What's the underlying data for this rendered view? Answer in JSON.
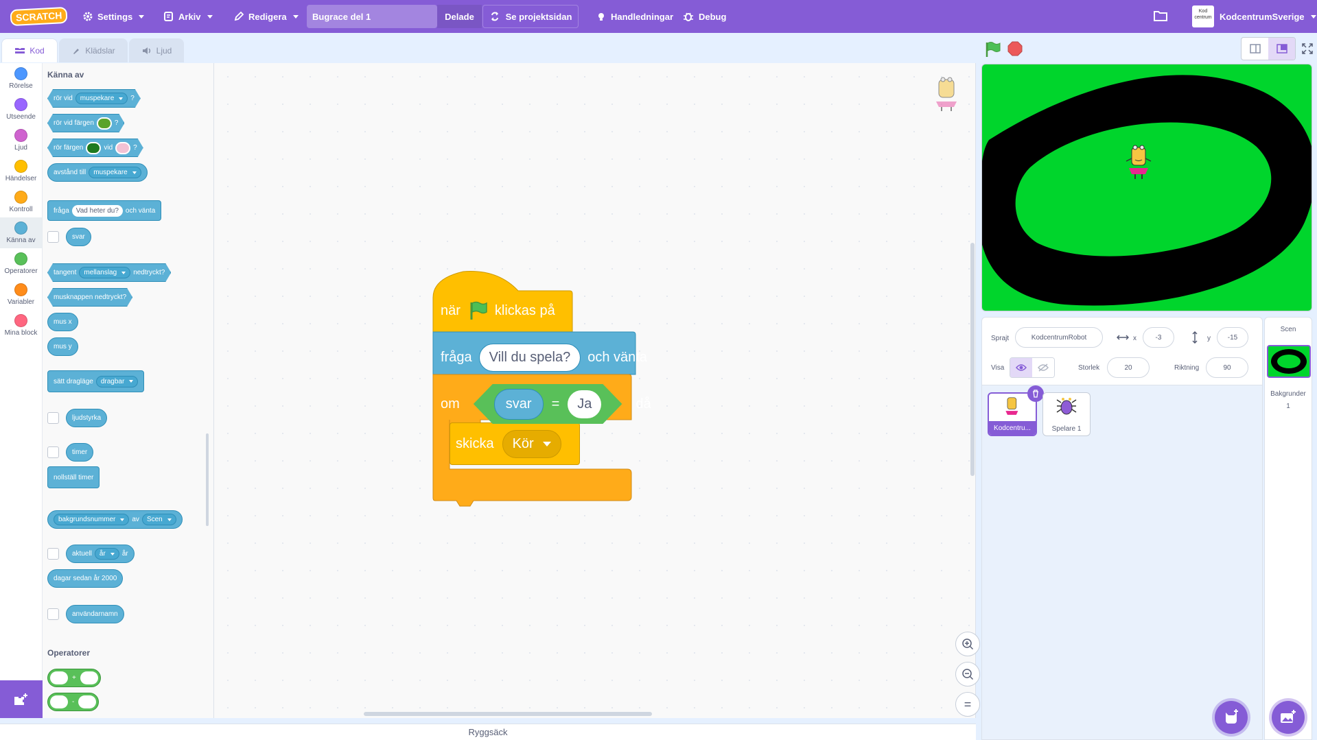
{
  "menu": {
    "logo": "SCRATCH",
    "settings": "Settings",
    "file": "Arkiv",
    "edit": "Redigera",
    "project_title": "Bugrace del 1",
    "shared": "Delade",
    "see_project_page": "Se projektsidan",
    "tutorials": "Handledningar",
    "debug": "Debug",
    "username": "KodcentrumSverige",
    "avatar_text": "Kod centrum"
  },
  "tabs": {
    "code": "Kod",
    "costumes": "Klädslar",
    "sounds": "Ljud"
  },
  "categories": [
    {
      "label": "Rörelse",
      "color": "#4c97ff"
    },
    {
      "label": "Utseende",
      "color": "#9966ff"
    },
    {
      "label": "Ljud",
      "color": "#cf63cf"
    },
    {
      "label": "Händelser",
      "color": "#ffbf00"
    },
    {
      "label": "Kontroll",
      "color": "#ffab19"
    },
    {
      "label": "Känna av",
      "color": "#5cb1d6"
    },
    {
      "label": "Operatorer",
      "color": "#59c059"
    },
    {
      "label": "Variabler",
      "color": "#ff8c1a"
    },
    {
      "label": "Mina block",
      "color": "#ff6680"
    }
  ],
  "palette": {
    "section_sensing": "Känna av",
    "touching_pre": "rör vid",
    "touching_dd": "muspekare",
    "q": "?",
    "touching_color_pre": "rör vid färgen",
    "color_touching_pre": "rör färgen",
    "color_touching_mid": "vid",
    "distance_pre": "avstånd till",
    "distance_dd": "muspekare",
    "ask_pre": "fråga",
    "ask_input": "Vad heter du?",
    "ask_post": "och vänta",
    "answer": "svar",
    "key_pre": "tangent",
    "key_dd": "mellanslag",
    "key_post": "nedtryckt?",
    "mouse_down": "musknappen nedtryckt?",
    "mouse_x": "mus x",
    "mouse_y": "mus y",
    "drag_pre": "sätt dragläge",
    "drag_dd": "dragbar",
    "loudness": "ljudstyrka",
    "timer": "timer",
    "reset_timer": "nollställ timer",
    "backdrop_dd": "bakgrundsnummer",
    "of": "av",
    "stage_dd": "Scen",
    "current_pre": "aktuell",
    "current_dd": "år",
    "current_post": "år",
    "days_since": "dagar sedan år 2000",
    "username": "användarnamn",
    "section_operators": "Operatorer",
    "plus": "+",
    "minus": "-"
  },
  "script": {
    "hat_pre": "när",
    "hat_post": "klickas på",
    "ask_pre": "fråga",
    "ask_input": "Vill du spela?",
    "ask_post": "och vänta",
    "if_pre": "om",
    "if_post": "då",
    "answer": "svar",
    "equals": "=",
    "compare_value": "Ja",
    "broadcast_pre": "skicka",
    "broadcast_msg": "Kör"
  },
  "workspace": {
    "zoom_reset": "="
  },
  "backpack": "Ryggsäck",
  "sprite_info": {
    "sprite_label": "Sprajt",
    "sprite_name": "KodcentrumRobot",
    "x_label": "x",
    "x_value": "-3",
    "y_label": "y",
    "y_value": "-15",
    "show_label": "Visa",
    "size_label": "Storlek",
    "size_value": "20",
    "direction_label": "Riktning",
    "direction_value": "90"
  },
  "sprites": [
    {
      "name": "Kodcentru...",
      "selected": true
    },
    {
      "name": "Spelare 1",
      "selected": false
    }
  ],
  "scene": {
    "title": "Scen",
    "backdrops_label": "Bakgrunder",
    "backdrops_count": "1"
  },
  "colors": {
    "menu_bg": "#855cd6",
    "sensing": "#5cb1d6",
    "events": "#ffbf00",
    "control": "#ffab19",
    "operators": "#59c059",
    "stage_green": "#00d52c"
  }
}
